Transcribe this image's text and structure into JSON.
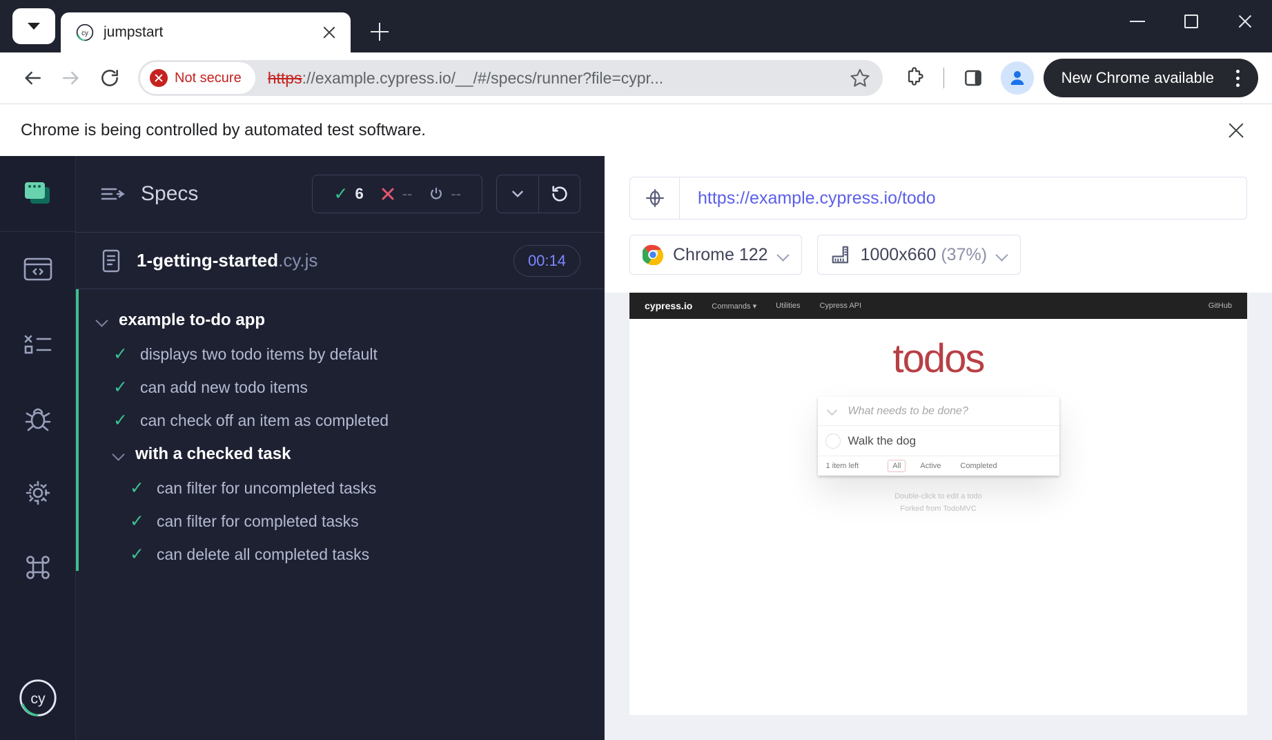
{
  "browser": {
    "tab": {
      "title": "jumpstart",
      "favicon": "cypress-icon"
    },
    "omnibox": {
      "security_label": "Not secure",
      "url_scheme": "https",
      "url_rest": "://example.cypress.io/__/#/specs/runner?file=cypr..."
    },
    "new_chrome_label": "New Chrome available",
    "infobar_text": "Chrome is being controlled by automated test software."
  },
  "runner": {
    "sidebar": [
      {
        "name": "projects",
        "icon": "windows-icon"
      },
      {
        "name": "specs",
        "icon": "code-window-icon"
      },
      {
        "name": "runs",
        "icon": "runs-list-icon"
      },
      {
        "name": "debug",
        "icon": "bug-icon"
      },
      {
        "name": "settings",
        "icon": "gear-icon"
      },
      {
        "name": "shortcuts",
        "icon": "keyboard-icon"
      }
    ],
    "specs_title": "Specs",
    "stats": {
      "passed": "6",
      "failed": "--",
      "pending": "--"
    },
    "spec": {
      "name": "1-getting-started",
      "ext": ".cy.js",
      "duration": "00:14"
    },
    "tree": {
      "suite": "example to-do app",
      "tests_top": [
        "displays two todo items by default",
        "can add new todo items",
        "can check off an item as completed"
      ],
      "nested_suite": "with a checked task",
      "tests_nested": [
        "can filter for uncompleted tasks",
        "can filter for completed tasks",
        "can delete all completed tasks"
      ]
    }
  },
  "preview": {
    "aut_url": "https://example.cypress.io/todo",
    "browser_pill": "Chrome 122",
    "viewport_size": "1000x660",
    "viewport_scale": "(37%)"
  },
  "app": {
    "nav": {
      "brand": "cypress.io",
      "links": [
        "Commands",
        "Utilities",
        "Cypress API"
      ],
      "right_link": "GitHub"
    },
    "title": "todos",
    "input_placeholder": "What needs to be done?",
    "items": [
      {
        "label": "Walk the dog",
        "completed": false
      }
    ],
    "count_text": "1 item left",
    "filters": [
      {
        "label": "All",
        "selected": true
      },
      {
        "label": "Active",
        "selected": false
      },
      {
        "label": "Completed",
        "selected": false
      }
    ],
    "hints": [
      "Double-click to edit a todo",
      "Forked from TodoMVC"
    ]
  },
  "colors": {
    "pass_green": "#3cc08f",
    "fail_red": "#e45770",
    "cypress_dark": "#1b1e2e",
    "aut_link_blue": "#5b5fe8",
    "todo_red": "#b83f45"
  }
}
